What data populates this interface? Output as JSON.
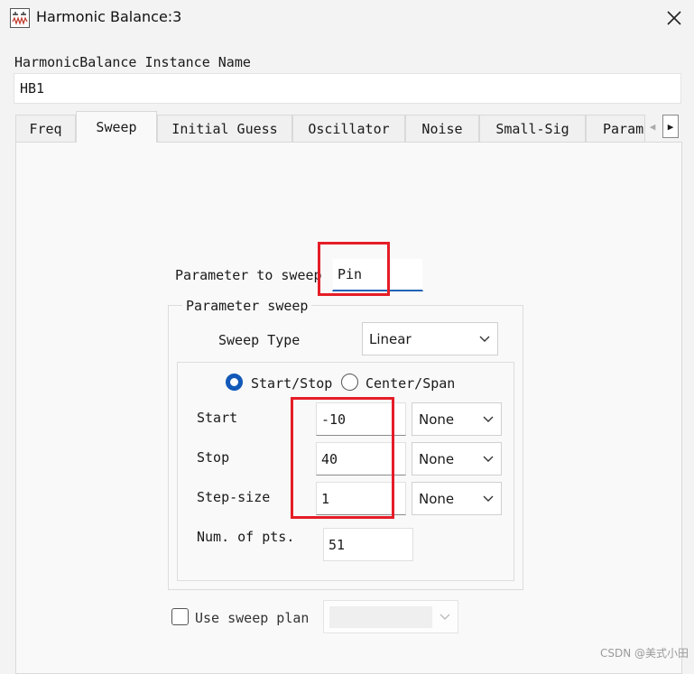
{
  "window": {
    "title": "Harmonic Balance:3",
    "icon": "harmonic-balance-icon",
    "close_icon": "close-icon"
  },
  "instance": {
    "label": "HarmonicBalance Instance Name",
    "value": "HB1"
  },
  "tabs": [
    {
      "label": "Freq"
    },
    {
      "label": "Sweep",
      "active": true
    },
    {
      "label": "Initial Guess"
    },
    {
      "label": "Oscillator"
    },
    {
      "label": "Noise"
    },
    {
      "label": "Small-Sig"
    },
    {
      "label": "Param"
    }
  ],
  "sweep": {
    "param_label": "Parameter to sweep",
    "param_value": "Pin",
    "group_title": "Parameter sweep",
    "type_label": "Sweep Type",
    "type_value": "Linear",
    "mode_start_stop": "Start/Stop",
    "mode_center_span": "Center/Span",
    "selected_mode": "Start/Stop",
    "rows": [
      {
        "label": "Start",
        "value": "-10",
        "unit": "None"
      },
      {
        "label": "Stop",
        "value": "40",
        "unit": "None"
      },
      {
        "label": "Step-size",
        "value": "1",
        "unit": "None"
      }
    ],
    "num_pts_label": "Num. of pts.",
    "num_pts_value": "51",
    "use_plan_label": "Use sweep plan",
    "use_plan_checked": false,
    "plan_value": ""
  },
  "watermark": "CSDN @美式小田",
  "colors": {
    "accent": "#1259b8",
    "highlight": "#e51d27"
  }
}
